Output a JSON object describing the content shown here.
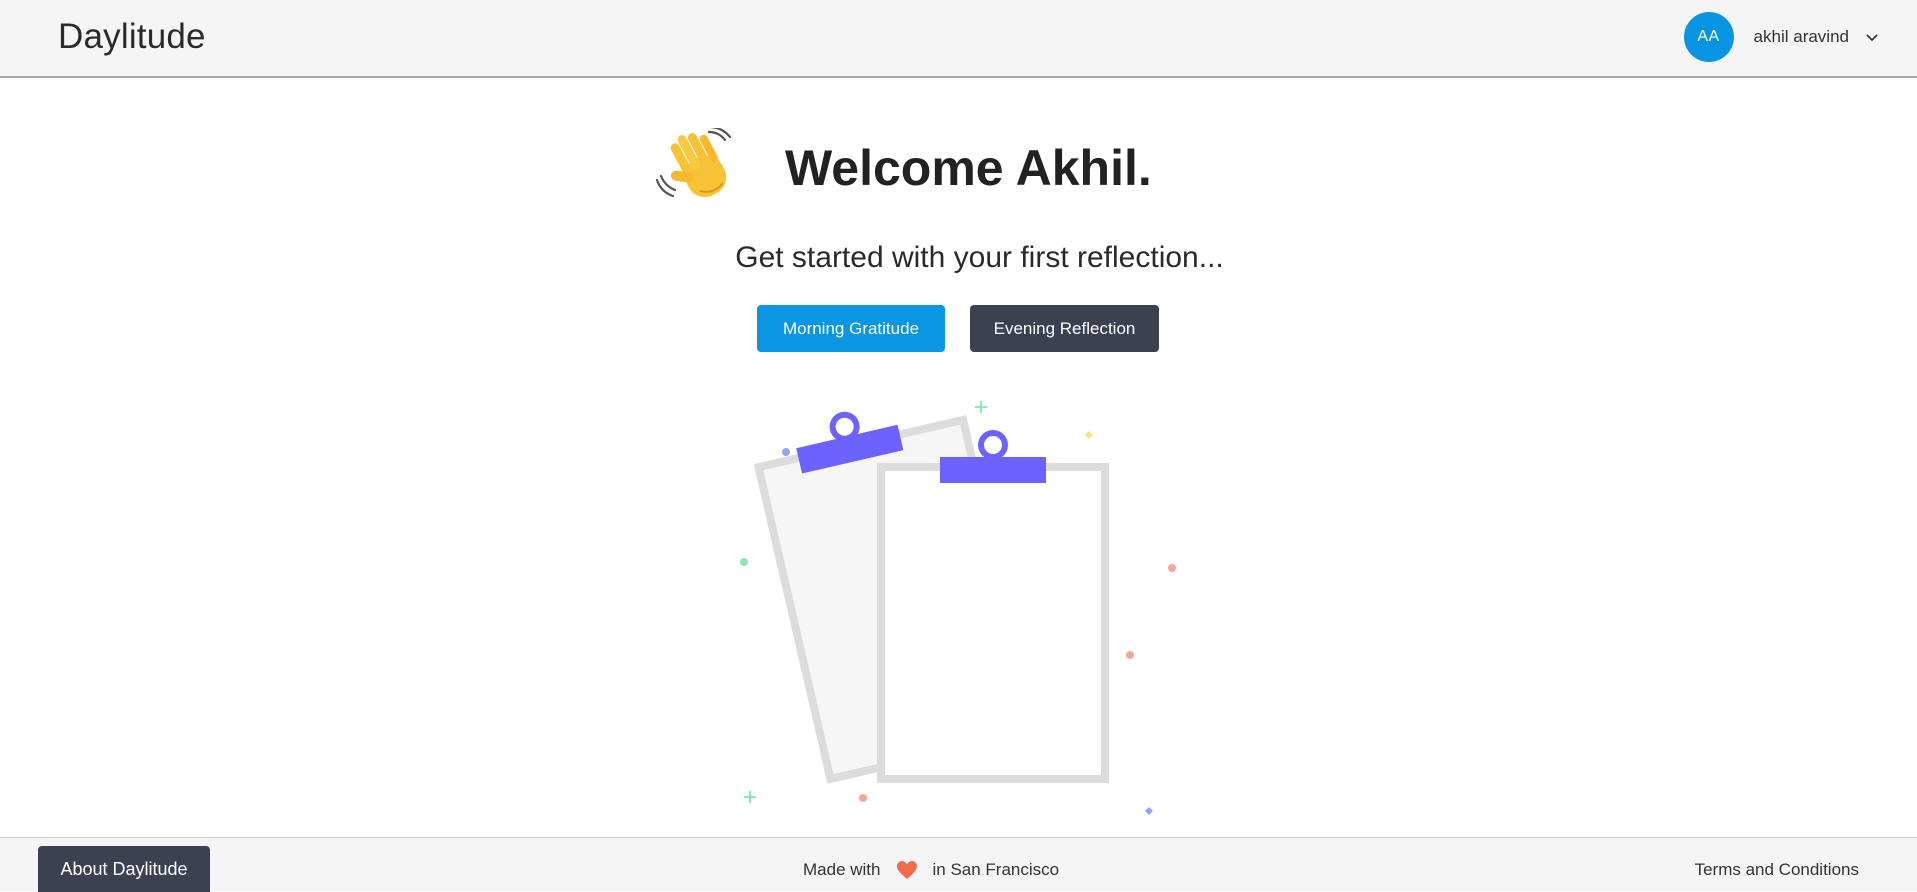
{
  "header": {
    "logo": "Daylitude",
    "user": {
      "initials": "AA",
      "name": "akhil aravind",
      "avatar_color": "#0795e3"
    }
  },
  "main": {
    "greeting_icon": "waving-hand-icon",
    "greeting": "Welcome Akhil.",
    "subtitle": "Get started with your first reflection...",
    "buttons": {
      "morning": "Morning Gratitude",
      "evening": "Evening Reflection"
    },
    "illustration": "clipboards-illustration"
  },
  "footer": {
    "about": "About Daylitude",
    "made_with_prefix": "Made with",
    "made_with_suffix": "in San Francisco",
    "heart_icon": "heart-icon",
    "terms": "Terms and Conditions"
  },
  "colors": {
    "primary": "#0a96e2",
    "dark": "#3b4150",
    "accent_purple": "#6c63ff",
    "heart": "#f26b4d"
  }
}
